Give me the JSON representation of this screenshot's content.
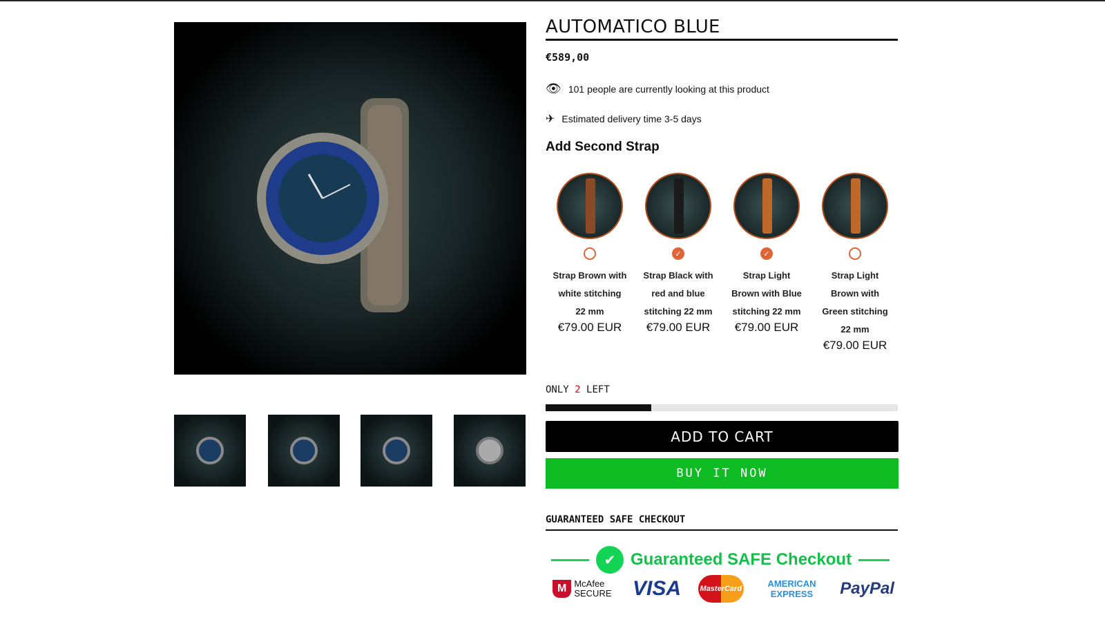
{
  "product": {
    "title": "AUTOMATICO BLUE",
    "price": "€589,00",
    "viewers": "101 people are currently looking at this product",
    "delivery": "Estimated delivery time 3-5 days"
  },
  "straps": {
    "heading": "Add Second Strap",
    "items": [
      {
        "name": "Strap Brown with white stitching 22 mm",
        "price": "€79.00 EUR",
        "selected": false,
        "color": "#8a4a25"
      },
      {
        "name": "Strap Black with red and blue stitching 22 mm",
        "price": "€79.00 EUR",
        "selected": true,
        "color": "#1a1a1a"
      },
      {
        "name": "Strap Light Brown with Blue stitching 22 mm",
        "price": "€79.00 EUR",
        "selected": true,
        "color": "#c0672a"
      },
      {
        "name": "Strap Light Brown with Green stitching 22 mm",
        "price": "€79.00 EUR",
        "selected": false,
        "color": "#c0672a"
      }
    ]
  },
  "stock": {
    "prefix": "ONLY",
    "count": "2",
    "suffix": "LEFT",
    "progress": 0.3
  },
  "buttons": {
    "add_to_cart": "ADD TO CART",
    "buy_now": "BUY IT NOW"
  },
  "checkout": {
    "heading": "GUARANTEED SAFE CHECKOUT",
    "badge": "Guaranteed SAFE Checkout",
    "logos": [
      "McAfee SECURE",
      "VISA",
      "MasterCard",
      "AMERICAN EXPRESS",
      "PayPal"
    ]
  },
  "colors": {
    "accent": "#e06536",
    "buy": "#10bc24",
    "badge": "#13c04a"
  }
}
